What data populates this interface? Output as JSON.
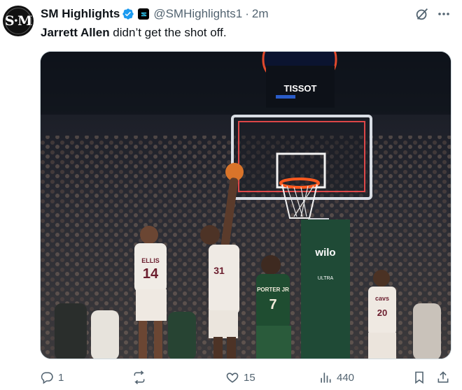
{
  "tweet": {
    "avatar_text": "S·M",
    "display_name": "SM Highlights",
    "handle": "@SMHighlights1",
    "separator": "·",
    "time": "2m",
    "text_mention": "Jarrett Allen",
    "text_rest": " didn’t get the shot off.",
    "media": {
      "scoreboard_brand": "TISSOT",
      "stanchion_brand": "wilo",
      "stanchion_sub": "ULTRA",
      "jersey_left": {
        "name": "ELLIS",
        "number": "14"
      },
      "jersey_center": {
        "number": "31"
      },
      "jersey_green": {
        "name": "PORTER JR",
        "number": "7"
      },
      "jersey_right": {
        "name": "cavs",
        "number": "20"
      }
    },
    "actions": {
      "replies": "1",
      "reposts": "",
      "likes": "15",
      "views": "440"
    },
    "colors": {
      "verified": "#1d9bf0",
      "muted": "#536471"
    }
  }
}
